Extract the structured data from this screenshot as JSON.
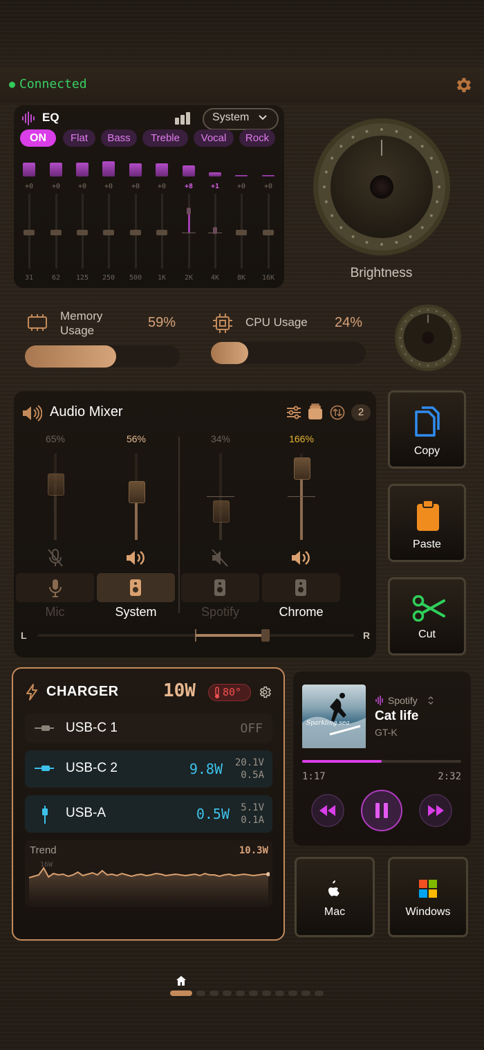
{
  "status": {
    "label": "Connected",
    "color": "#37d063"
  },
  "eq": {
    "title": "EQ",
    "preset": "System",
    "toggle": "ON",
    "presets": [
      "Flat",
      "Bass",
      "Treble",
      "Vocal",
      "Rock"
    ],
    "bands": [
      {
        "freq": "31",
        "gain": "+0",
        "level": 0.62
      },
      {
        "freq": "62",
        "gain": "+0",
        "level": 0.62
      },
      {
        "freq": "125",
        "gain": "+0",
        "level": 0.62
      },
      {
        "freq": "250",
        "gain": "+0",
        "level": 0.68
      },
      {
        "freq": "500",
        "gain": "+0",
        "level": 0.6
      },
      {
        "freq": "1K",
        "gain": "+0",
        "level": 0.6
      },
      {
        "freq": "2K",
        "gain": "+8",
        "level": 0.5
      },
      {
        "freq": "4K",
        "gain": "+1",
        "level": 0.2
      },
      {
        "freq": "8K",
        "gain": "+0",
        "level": 0.02
      },
      {
        "freq": "16K",
        "gain": "+0",
        "level": 0.02
      }
    ]
  },
  "brightness": {
    "label": "Brightness"
  },
  "memory": {
    "label": "Memory Usage",
    "line1": "Memory",
    "line2": "Usage",
    "value": "59%",
    "fraction": 0.59
  },
  "cpu": {
    "label": "CPU Usage",
    "value": "24%",
    "fraction": 0.24
  },
  "mixer": {
    "title": "Audio Mixer",
    "badge": "2",
    "channels": [
      {
        "name": "Mic",
        "pct": "65%",
        "level": 0.65,
        "active": false,
        "muted": true,
        "pct_color": "#6b6258"
      },
      {
        "name": "System",
        "pct": "56%",
        "level": 0.56,
        "active": true,
        "muted": false,
        "pct_color": "#e2b890"
      },
      {
        "name": "Spotify",
        "pct": "34%",
        "level": 0.34,
        "active": false,
        "muted": true,
        "pct_color": "#6b6258"
      },
      {
        "name": "Chrome",
        "pct": "166%",
        "level": 0.83,
        "active": true,
        "muted": false,
        "pct_color": "#e5b733"
      }
    ],
    "balance": {
      "left": "L",
      "right": "R",
      "value": 0.72
    }
  },
  "actions": {
    "copy": "Copy",
    "paste": "Paste",
    "cut": "Cut"
  },
  "charger": {
    "title": "CHARGER",
    "total": "10W",
    "temp": "80°",
    "ports": [
      {
        "name": "USB-C 1",
        "watts": "OFF",
        "volts": "",
        "amps": ""
      },
      {
        "name": "USB-C 2",
        "watts": "9.8W",
        "volts": "20.1V",
        "amps": "0.5A"
      },
      {
        "name": "USB-A",
        "watts": "0.5W",
        "volts": "5.1V",
        "amps": "0.1A"
      }
    ],
    "trend": {
      "label": "Trend",
      "peak": "10.3W",
      "axis": "16W"
    }
  },
  "media": {
    "source": "Spotify",
    "track": "Cat life",
    "artist": "GT-K",
    "elapsed": "1:17",
    "duration": "2:32",
    "progress": 0.5,
    "album_caption": "Sparkling sea"
  },
  "os": {
    "mac": "Mac",
    "windows": "Windows"
  },
  "pager": {
    "pages": 11,
    "current": 0
  }
}
